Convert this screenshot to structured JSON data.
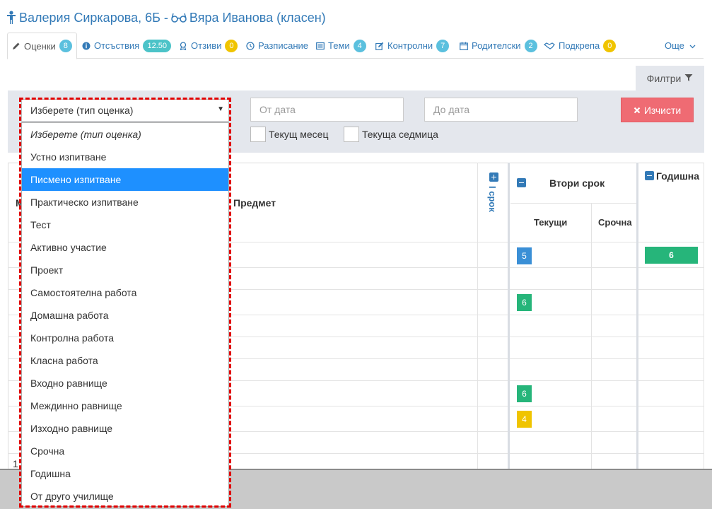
{
  "header": {
    "student_name": "Валерия Сиркарова, 6Б -",
    "teacher_name": "Вяра Иванова (класен)"
  },
  "tabs": [
    {
      "label": "Оценки",
      "badge": "8",
      "icon": "pencil-icon"
    },
    {
      "label": "Отсъствия",
      "badge": "12.50",
      "icon": "info-circle-icon"
    },
    {
      "label": "Отзиви",
      "badge": "0",
      "icon": "award-icon"
    },
    {
      "label": "Разписание",
      "badge": "",
      "icon": "clock-icon"
    },
    {
      "label": "Теми",
      "badge": "4",
      "icon": "list-icon"
    },
    {
      "label": "Контролни",
      "badge": "7",
      "icon": "edit-icon"
    },
    {
      "label": "Родителски",
      "badge": "2",
      "icon": "calendar-icon"
    },
    {
      "label": "Подкрепа",
      "badge": "0",
      "icon": "handshake-icon"
    }
  ],
  "more_label": "Още",
  "filter": {
    "tab_label": "Филтри",
    "from_date_placeholder": "От дата",
    "to_date_placeholder": "До дата",
    "current_month_label": "Текущ месец",
    "current_week_label": "Текуща седмица",
    "clear_label": "Изчисти"
  },
  "select": {
    "selected_value": "Изберете (тип оценка)",
    "options": [
      "Изберете (тип оценка)",
      "Устно изпитване",
      "Писмено изпитване",
      "Практическо изпитване",
      "Тест",
      "Активно участие",
      "Проект",
      "Самостоятелна работа",
      "Домашна работа",
      "Контролна работа",
      "Класна работа",
      "Входно равнище",
      "Междинно равнище",
      "Изходно равнище",
      "Срочна",
      "Годишна",
      "От друго училище"
    ],
    "highlighted_option": "Писмено изпитване"
  },
  "table": {
    "col_number_partial": "М",
    "col_subject": "Предмет",
    "term1_label": "I срок",
    "term2_label": "Втори срок",
    "term2_current": "Текущи",
    "term2_final": "Срочна",
    "annual_label": "Годишна",
    "row_number_partial": "1",
    "grades": [
      {
        "row": 1,
        "column": "Текущи",
        "value": "5",
        "color": "#3a8fd6"
      },
      {
        "row": 1,
        "column": "Годишна",
        "value": "6",
        "color": "#26b57a"
      },
      {
        "row": 3,
        "column": "Текущи",
        "value": "6",
        "color": "#26b57a"
      },
      {
        "row": 7,
        "column": "Текущи",
        "value": "6",
        "color": "#26b57a"
      },
      {
        "row": 8,
        "column": "Текущи",
        "value": "4",
        "color": "#f0c400"
      }
    ]
  },
  "colors": {
    "link": "#337ab7",
    "danger": "#ef6b73",
    "selected_option": "#1e90ff",
    "highlight_border": "#e00000"
  }
}
